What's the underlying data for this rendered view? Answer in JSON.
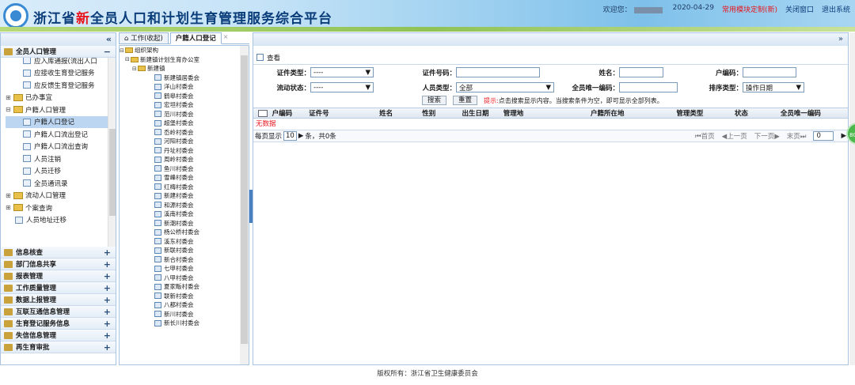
{
  "header": {
    "title_pre": "浙江省",
    "title_hl": "新",
    "title_post": "全员人口和计划生育管理服务综合平台",
    "welcome": "欢迎您：",
    "date": "2020-04-29",
    "custom": "常用模块定制(新)",
    "close": "关闭窗口",
    "exit": "退出系统"
  },
  "sidebar": {
    "collapse": "«",
    "group_main": "全员人口管理",
    "items": [
      {
        "label": "应入库通报(流出人口",
        "type": "page"
      },
      {
        "label": "应接收生育登记服务",
        "type": "page"
      },
      {
        "label": "应反馈生育登记服务",
        "type": "page"
      },
      {
        "label": "已办事宜",
        "type": "folder",
        "tog": "⊞"
      },
      {
        "label": "户籍人口管理",
        "type": "folder",
        "tog": "⊟"
      },
      {
        "label": "户籍人口登记",
        "type": "page",
        "selected": true
      },
      {
        "label": "户籍人口流出登记",
        "type": "page"
      },
      {
        "label": "户籍人口流出查询",
        "type": "page"
      },
      {
        "label": "人员注销",
        "type": "page"
      },
      {
        "label": "人员迁移",
        "type": "page"
      },
      {
        "label": "全员通讯录",
        "type": "page"
      },
      {
        "label": "流动人口管理",
        "type": "folder",
        "tog": "⊞"
      },
      {
        "label": "个案查询",
        "type": "folder",
        "tog": "⊞"
      },
      {
        "label": "人员地址迁移",
        "type": "page"
      }
    ],
    "groups": [
      "信息核查",
      "部门信息共享",
      "报表管理",
      "工作质量管理",
      "数据上报管理",
      "互联互通信息管理",
      "生育登记服务信息",
      "失信信息管理",
      "再生育审批"
    ],
    "plus": "+"
  },
  "tabs": [
    {
      "label": "⌂ 工作(收起)"
    },
    {
      "label": "户籍人口登记"
    }
  ],
  "tab_close": "×",
  "org": {
    "root": "组织架构",
    "office": "新建镇计划生育办公室",
    "town": "新建镇",
    "villages": [
      "新建镇居委会",
      "洋山村委会",
      "鹤皋村委会",
      "宏坦村委会",
      "范川村委会",
      "超堡村委会",
      "岙岭村委会",
      "河阳村委会",
      "丹址村委会",
      "周岭村委会",
      "鱼川村委会",
      "雪峰村委会",
      "红梅村委会",
      "新建村委会",
      "和源村委会",
      "溪南村委会",
      "新潮村委会",
      "杨公桥村委会",
      "溪东村委会",
      "新联村委会",
      "新合村委会",
      "七甲村委会",
      "八甲村委会",
      "夏家畈村委会",
      "联新村委会",
      "八都村委会",
      "新川村委会",
      "新长川村委会"
    ]
  },
  "main": {
    "collapse": "»",
    "view": "查看",
    "form": {
      "id_type_label": "证件类型：",
      "id_type_value": "----",
      "id_no_label": "证件号码：",
      "name_label": "姓名：",
      "hh_no_label": "户编码：",
      "move_label": "流动状态：",
      "move_value": "----",
      "ptype_label": "人员类型：",
      "ptype_value": "全部",
      "uid_label": "全员唯一编码：",
      "sort_label": "排序类型：",
      "sort_value": "操作日期"
    },
    "search_btn": "搜索",
    "reset_btn": "重置",
    "hint_red": "提示:",
    "hint": "点击搜索显示内容。当搜索条件为空，即可显示全部列表。",
    "columns": [
      "户编码",
      "证件号",
      "姓名",
      "性别",
      "出生日期",
      "管理地",
      "户籍所在地",
      "管理类型",
      "状态",
      "全员唯一编码"
    ],
    "nodata": "无数据",
    "pager": {
      "per_page_label": "每页显示",
      "per_page": "10",
      "tail": "条，共0条",
      "first": "首页",
      "prev": "上一页",
      "next": "下一页",
      "last": "末页",
      "page": "0"
    }
  },
  "footer": "版权所有：浙江省卫生健康委员会",
  "side_badge": "80"
}
